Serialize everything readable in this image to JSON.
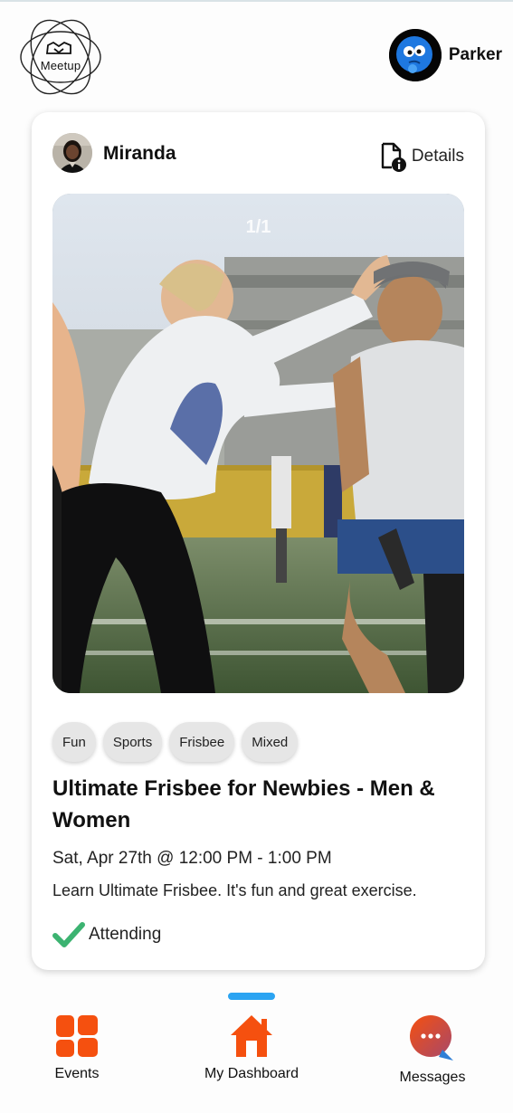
{
  "header": {
    "logo_text": "Meetup",
    "logo_icon": "handshake-icon",
    "user_name": "Parker"
  },
  "event": {
    "host_name": "Miranda",
    "details_label": "Details",
    "photo_counter": "1/1",
    "tags": [
      "Fun",
      "Sports",
      "Frisbee",
      "Mixed"
    ],
    "title": "Ultimate Frisbee for Newbies - Men & Women",
    "datetime": "Sat, Apr 27th @ 12:00 PM - 1:00 PM",
    "description": "Learn Ultimate Frisbee. It's fun and great exercise.",
    "status": "Attending"
  },
  "nav": {
    "events_label": "Events",
    "dashboard_label": "My Dashboard",
    "messages_label": "Messages"
  },
  "colors": {
    "accent_orange": "#f5500f",
    "indicator_blue": "#2ba4f2",
    "check_green": "#3cb371"
  }
}
